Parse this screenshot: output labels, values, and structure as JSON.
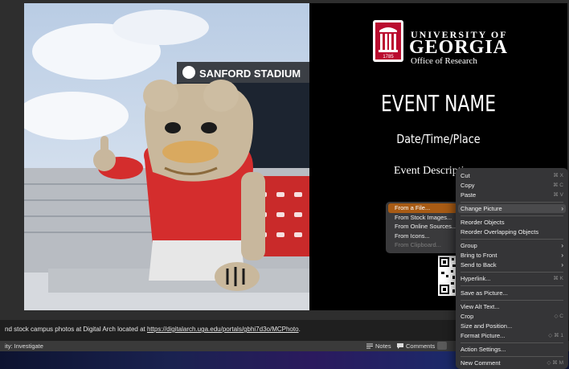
{
  "slide": {
    "photo_sign": "SANFORD STADIUM",
    "university": {
      "line1": "UNIVERSITY OF",
      "line2": "GEORGIA",
      "line3": "Office of Research",
      "year": "1785"
    },
    "event_name": "EVENT NAME",
    "date_line": "Date/Time/Place",
    "description": "Event Descripti"
  },
  "notes": {
    "text_before": "nd stock campus photos at Digital Arch located at ",
    "link": "https://digitalarch.uga.edu/portals/gbhi7d3o/MCPhoto",
    "text_after": "."
  },
  "status_bar": {
    "accessibility": "ity: Investigate",
    "notes_label": "Notes",
    "comments_label": "Comments"
  },
  "context_menu": {
    "items": [
      {
        "label": "Cut",
        "shortcut": "⌘ X"
      },
      {
        "label": "Copy",
        "shortcut": "⌘ C"
      },
      {
        "label": "Paste",
        "shortcut": "⌘ V"
      },
      {
        "label": "Change Picture",
        "submenu": true
      },
      {
        "label": "Reorder Objects"
      },
      {
        "label": "Reorder Overlapping Objects"
      },
      {
        "label": "Group",
        "submenu": true
      },
      {
        "label": "Bring to Front",
        "submenu": true
      },
      {
        "label": "Send to Back",
        "submenu": true
      },
      {
        "label": "Hyperlink...",
        "shortcut": "⌘ K"
      },
      {
        "label": "Save as Picture..."
      },
      {
        "label": "View Alt Text..."
      },
      {
        "label": "Crop",
        "shortcut": "◇ C"
      },
      {
        "label": "Size and Position..."
      },
      {
        "label": "Format Picture...",
        "shortcut": "◇ ⌘ 1"
      },
      {
        "label": "Action Settings..."
      },
      {
        "label": "New Comment",
        "shortcut": "◇ ⌘ M"
      }
    ]
  },
  "change_picture_submenu": {
    "items": [
      {
        "label": "From a File...",
        "highlighted": true
      },
      {
        "label": "From Stock Images..."
      },
      {
        "label": "From Online Sources..."
      },
      {
        "label": "From Icons..."
      },
      {
        "label": "From Clipboard...",
        "disabled": true
      }
    ]
  },
  "colors": {
    "menu_bg": "#353537",
    "highlight": "#a85b14",
    "uga_red": "#ba0c2f"
  }
}
